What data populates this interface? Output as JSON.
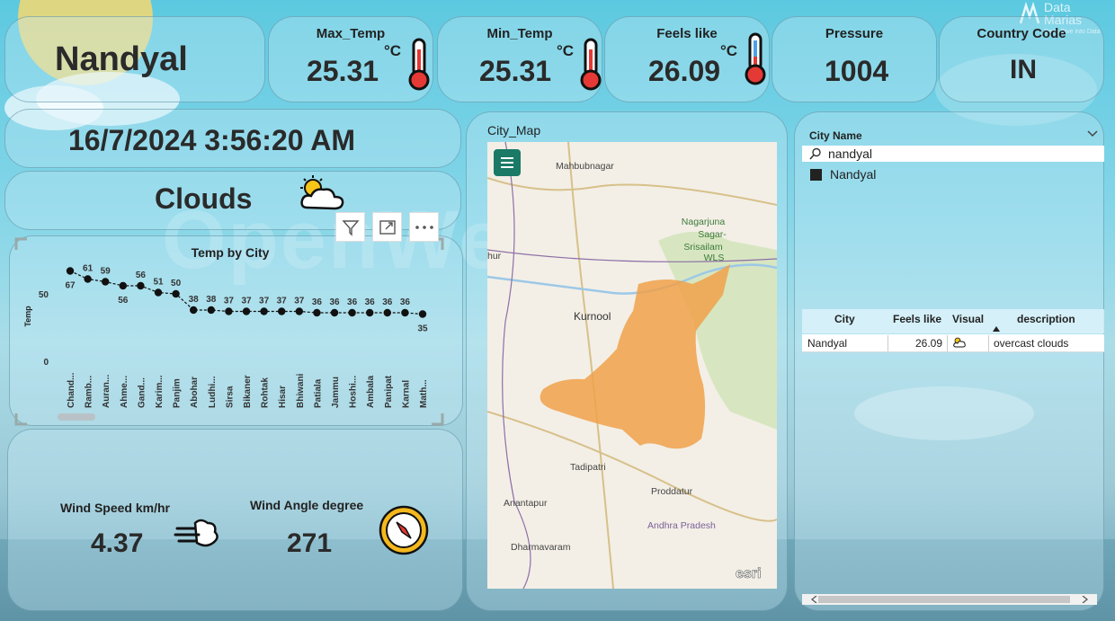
{
  "background_watermark": "OpenWeather",
  "logo": {
    "line1": "Data",
    "line2": "Marias",
    "tagline": "Deep Dive into Data"
  },
  "city": "Nandyal",
  "kpis": {
    "max_temp": {
      "title": "Max_Temp",
      "value": "25.31",
      "unit": "°C"
    },
    "min_temp": {
      "title": "Min_Temp",
      "value": "25.31",
      "unit": "°C"
    },
    "feels_like": {
      "title": "Feels like",
      "value": "26.09",
      "unit": "°C"
    },
    "pressure": {
      "title": "Pressure",
      "value": "1004"
    },
    "country": {
      "title": "Country Code",
      "value": "IN"
    }
  },
  "datetime": "16/7/2024 3:56:20 AM",
  "weather": "Clouds",
  "toolbar": {
    "filter_icon": "filter-icon",
    "focus_icon": "focus-mode-icon",
    "more_icon": "more-options-icon"
  },
  "chart_data": {
    "type": "line",
    "title": "Temp by City",
    "ylabel": "Temp",
    "yticks": [
      0,
      50
    ],
    "ylim": [
      0,
      80
    ],
    "categories": [
      "Chand...",
      "Ramb...",
      "Auran...",
      "Ahme...",
      "Gand...",
      "Karim...",
      "Panjim",
      "Abohar",
      "Ludhi...",
      "Sirsa",
      "Bikaner",
      "Rohtak",
      "Hisar",
      "Bhiwani",
      "Patiala",
      "Jammu",
      "Hoshi...",
      "Ambala",
      "Panipat",
      "Karnal",
      "Math..."
    ],
    "values": [
      67,
      61,
      59,
      56,
      56,
      51,
      50,
      38,
      38,
      37,
      37,
      37,
      37,
      37,
      36,
      36,
      36,
      36,
      36,
      36,
      35
    ]
  },
  "wind": {
    "speed_title": "Wind Speed km/hr",
    "speed_value": "4.37",
    "angle_title": "Wind Angle degree",
    "angle_value": "271"
  },
  "map": {
    "title": "City_Map",
    "places": [
      "Mahbubnagar",
      "Nagarjuna",
      "Sagar-",
      "Srisailam",
      "WLS",
      "Kurnool",
      "hur",
      "Tadipatri",
      "Proddatur",
      "Anantapur",
      "Andhra Pradesh",
      "Dharmavaram"
    ],
    "attribution": "esri",
    "region_color": "#f0a14a"
  },
  "slicer": {
    "title": "City Name",
    "search_value": "nandyal",
    "option": "Nandyal"
  },
  "table": {
    "columns": [
      "City",
      "Feels like",
      "Visual",
      "description"
    ],
    "row": {
      "city": "Nandyal",
      "feels_like": "26.09",
      "description": "overcast clouds"
    }
  }
}
